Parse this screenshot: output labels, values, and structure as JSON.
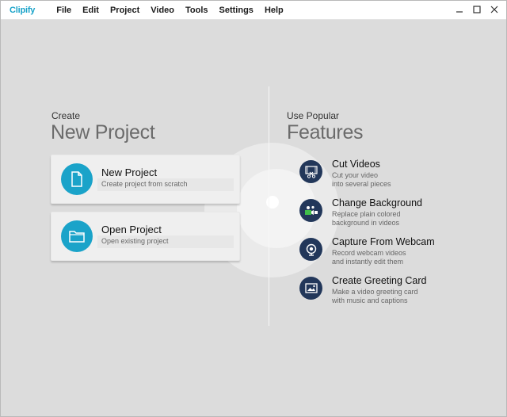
{
  "app": {
    "logo": "Clipify"
  },
  "menu": {
    "items": [
      "File",
      "Edit",
      "Project",
      "Video",
      "Tools",
      "Settings",
      "Help"
    ]
  },
  "window_controls": {
    "minimize": "—",
    "maximize": "☐",
    "close": "✕"
  },
  "create": {
    "label": "Create",
    "heading": "New Project",
    "cards": [
      {
        "title": "New Project",
        "subtitle": "Create project from scratch",
        "icon": "document-icon"
      },
      {
        "title": "Open Project",
        "subtitle": "Open existing project",
        "icon": "folder-icon"
      }
    ]
  },
  "features": {
    "label": "Use Popular",
    "heading": "Features",
    "items": [
      {
        "title": "Cut Videos",
        "line1": "Cut your video",
        "line2": "into several pieces",
        "icon": "scissors-film-icon"
      },
      {
        "title": "Change Background",
        "line1": "Replace plain colored",
        "line2": "background in videos",
        "icon": "chroma-key-icon"
      },
      {
        "title": "Capture From Webcam",
        "line1": "Record webcam videos",
        "line2": "and instantly edit them",
        "icon": "webcam-icon"
      },
      {
        "title": "Create Greeting Card",
        "line1": "Make a video greeting card",
        "line2": "with music and captions",
        "icon": "picture-icon"
      }
    ]
  },
  "colors": {
    "accent": "#1aa3c9",
    "feature_icon_bg": "#22375a",
    "background": "#dcdcdc"
  }
}
